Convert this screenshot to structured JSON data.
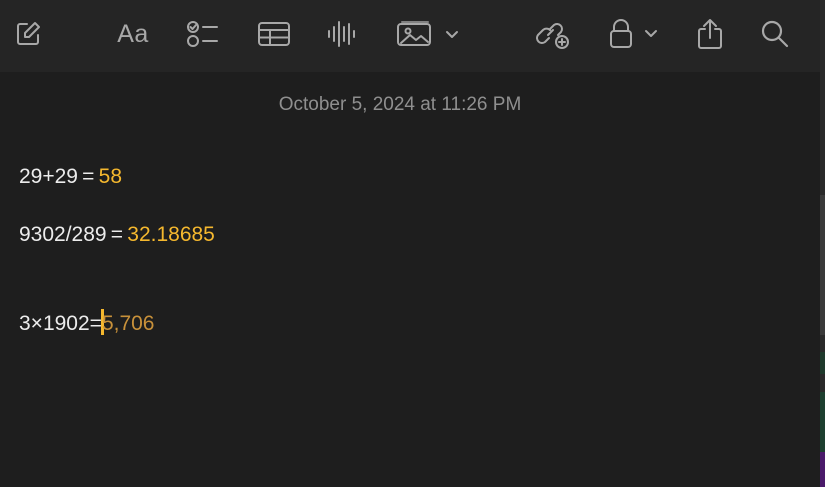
{
  "toolbar": {
    "buttons": [
      {
        "name": "compose-icon"
      },
      {
        "name": "format-text",
        "label": "Aa"
      },
      {
        "name": "checklist-icon"
      },
      {
        "name": "table-icon"
      },
      {
        "name": "audio-waveform-icon"
      },
      {
        "name": "media-icon"
      },
      {
        "name": "collaborate-icon"
      },
      {
        "name": "lock-icon"
      },
      {
        "name": "share-icon"
      },
      {
        "name": "search-icon"
      }
    ]
  },
  "note": {
    "timestamp": "October 5, 2024 at 11:26 PM",
    "lines": [
      {
        "expression": "29+29 = ",
        "result": "58"
      },
      {
        "expression": "9302/289 = ",
        "result": "32.18685"
      },
      {
        "expression": "3×1902=",
        "result": "5,706"
      }
    ]
  },
  "colors": {
    "background": "#1e1e1e",
    "toolbar": "#252525",
    "icon": "#a8a8a8",
    "text": "#ececec",
    "timestamp": "#8f8f8f",
    "result_accent": "#f5b82e"
  }
}
